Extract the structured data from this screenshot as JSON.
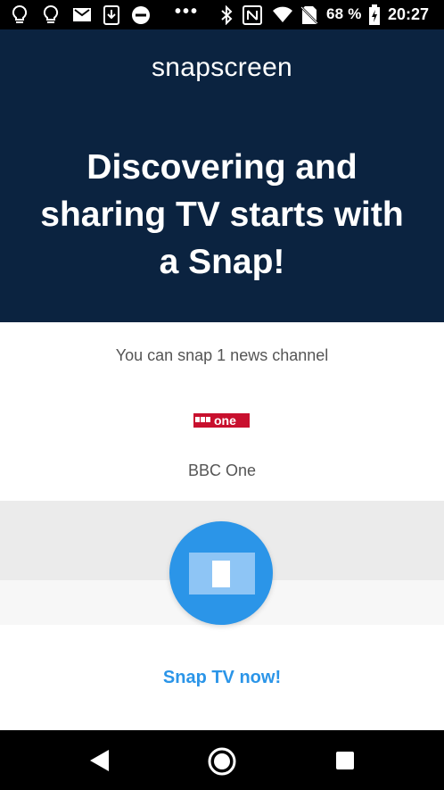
{
  "status_bar": {
    "battery_percent": "68 %",
    "time": "20:27",
    "overflow": "•••",
    "icons": [
      "lightbulb-icon",
      "lightbulb-outline-icon",
      "gmail-icon",
      "download-icon",
      "do-not-disturb-icon",
      "bluetooth-icon",
      "nfc-icon",
      "wifi-icon",
      "no-sim-icon",
      "battery-charging-icon"
    ]
  },
  "header": {
    "brand": "snapscreen",
    "headline": "Discovering and sharing TV starts with a Snap!",
    "background": "#0b2340"
  },
  "info": {
    "snap_text": "You can snap 1 news channel",
    "channel_name": "BBC One",
    "channel_logo_text": "BBC one"
  },
  "snap": {
    "cta_label": "Snap TV now!",
    "accent": "#2b95e8"
  },
  "nav": {
    "icons": [
      "back-icon",
      "home-icon",
      "recents-icon"
    ]
  }
}
